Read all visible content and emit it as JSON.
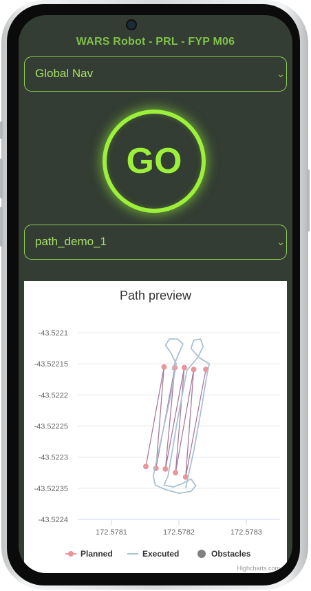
{
  "app": {
    "title": "WARS Robot - PRL - FYP M06"
  },
  "navigation_mode": {
    "selected": "Global Nav"
  },
  "go_button": {
    "label": "GO"
  },
  "path_select": {
    "selected": "path_demo_1"
  },
  "colors": {
    "screen_bg": "#333d33",
    "accent": "#9cf03a",
    "planned": "#e8959b",
    "executed": "#aac0d4",
    "obstacles": "#808080"
  },
  "chart_data": {
    "type": "line",
    "title": "Path preview",
    "xlabel": "",
    "ylabel": "",
    "xlim": [
      172.57805,
      172.57835
    ],
    "ylim": [
      -43.5224,
      -43.52207
    ],
    "x_ticks": [
      "172.5781",
      "172.5782",
      "172.5783"
    ],
    "x_tick_values": [
      172.5781,
      172.5782,
      172.5783
    ],
    "y_ticks": [
      "-43.5221",
      "-43.52215",
      "-43.5222",
      "-43.52225",
      "-43.5223",
      "-43.52235",
      "-43.5224"
    ],
    "y_tick_values": [
      -43.5221,
      -43.52215,
      -43.5222,
      -43.52225,
      -43.5223,
      -43.52235,
      -43.5224
    ],
    "series": [
      {
        "name": "Planned",
        "color": "#e8959b",
        "marker": true,
        "points": [
          [
            172.578151,
            -43.522315
          ],
          [
            172.578178,
            -43.522155
          ],
          [
            172.578166,
            -43.522318
          ],
          [
            172.578194,
            -43.522156
          ],
          [
            172.57818,
            -43.522319
          ],
          [
            172.578208,
            -43.522156
          ],
          [
            172.578195,
            -43.522325
          ],
          [
            172.578222,
            -43.522159
          ],
          [
            172.57821,
            -43.522332
          ],
          [
            172.57824,
            -43.522159
          ]
        ]
      },
      {
        "name": "Executed",
        "color": "#aac0d4",
        "marker": false,
        "points": [
          [
            172.57821,
            -43.52235
          ],
          [
            172.578222,
            -43.52229
          ],
          [
            172.578232,
            -43.52223
          ],
          [
            172.578242,
            -43.522165
          ],
          [
            172.578245,
            -43.52215
          ],
          [
            172.57823,
            -43.52214
          ],
          [
            172.578218,
            -43.522125
          ],
          [
            172.578222,
            -43.522112
          ],
          [
            172.578232,
            -43.52211
          ],
          [
            172.578236,
            -43.522122
          ],
          [
            172.578228,
            -43.52214
          ],
          [
            172.578212,
            -43.52216
          ],
          [
            172.578198,
            -43.52224
          ],
          [
            172.578184,
            -43.52233
          ],
          [
            172.578178,
            -43.522345
          ],
          [
            172.578192,
            -43.522348
          ],
          [
            172.578206,
            -43.522342
          ],
          [
            172.578218,
            -43.522335
          ],
          [
            172.578225,
            -43.522346
          ],
          [
            172.578218,
            -43.522355
          ],
          [
            172.5782,
            -43.522358
          ],
          [
            172.57818,
            -43.522352
          ],
          [
            172.578165,
            -43.522345
          ],
          [
            172.578162,
            -43.52233
          ],
          [
            172.578174,
            -43.52227
          ],
          [
            172.578188,
            -43.5222
          ],
          [
            172.578196,
            -43.52215
          ],
          [
            172.578188,
            -43.522132
          ],
          [
            172.57818,
            -43.52212
          ],
          [
            172.578186,
            -43.52211
          ],
          [
            172.578198,
            -43.52211
          ],
          [
            172.578206,
            -43.522118
          ],
          [
            172.578198,
            -43.522138
          ],
          [
            172.57819,
            -43.52216
          ]
        ]
      },
      {
        "name": "Obstacles",
        "color": "#808080",
        "marker": true,
        "points": []
      }
    ],
    "legend": {
      "position": "bottom",
      "items": [
        "Planned",
        "Executed",
        "Obstacles"
      ]
    },
    "credits": "Highcharts.com",
    "grid": true
  }
}
